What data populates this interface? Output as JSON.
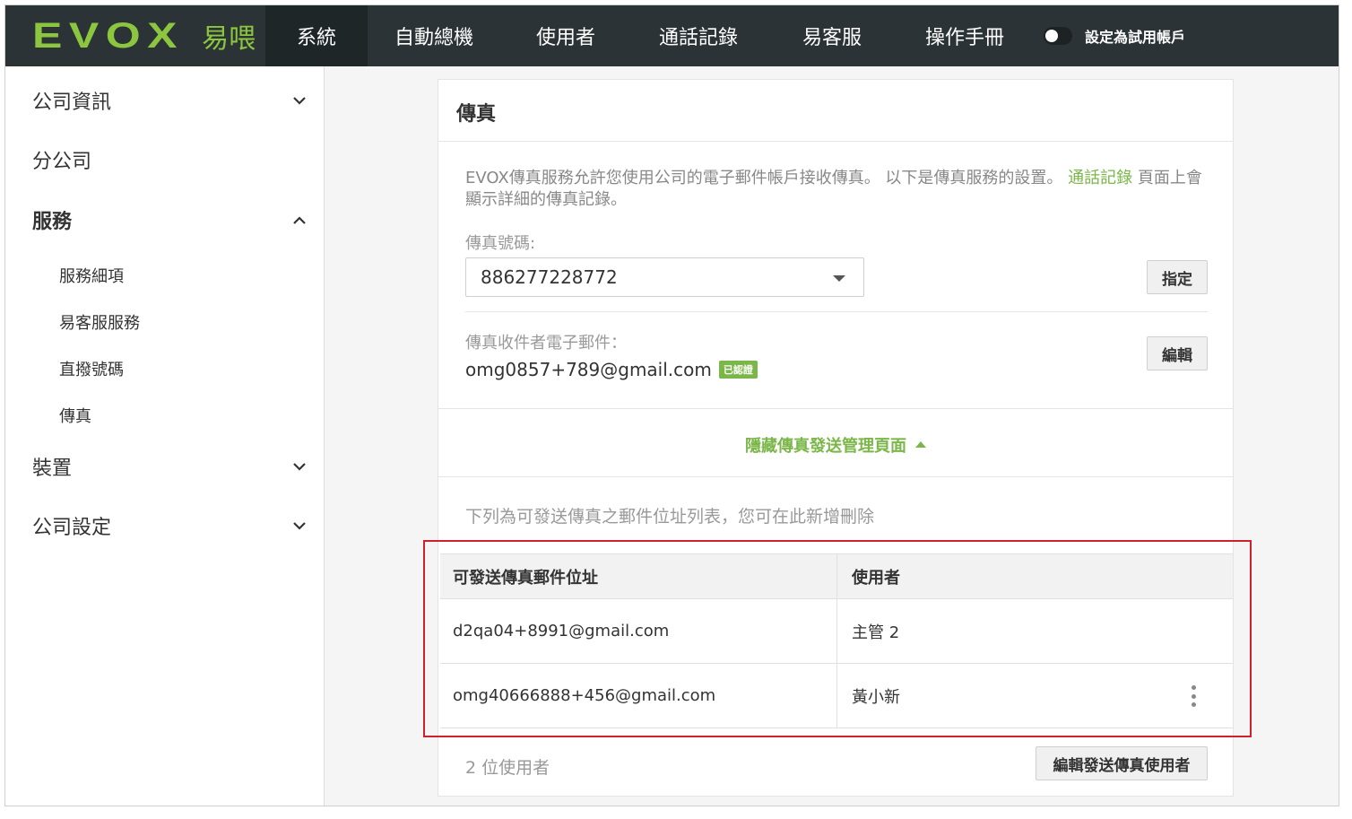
{
  "logo": {
    "mark": "EVOX",
    "sub": "易喂"
  },
  "nav": {
    "items": [
      {
        "label": "系統",
        "active": true
      },
      {
        "label": "自動總機",
        "active": false
      },
      {
        "label": "使用者",
        "active": false
      },
      {
        "label": "通話記錄",
        "active": false
      },
      {
        "label": "易客服",
        "active": false
      },
      {
        "label": "操作手冊",
        "active": false
      }
    ],
    "trial_label": "設定為試用帳戶"
  },
  "sidebar": {
    "company_info": "公司資訊",
    "branch": "分公司",
    "services": "服務",
    "service_items": [
      "服務細項",
      "易客服服務",
      "直撥號碼",
      "傳真"
    ],
    "devices": "裝置",
    "company_settings": "公司設定"
  },
  "fax": {
    "title": "傳真",
    "desc_before": "EVOX傳真服務允許您使用公司的電子郵件帳戶接收傳真。 以下是傳真服務的設置。 ",
    "desc_link": "通話記錄",
    "desc_after": " 頁面上會顯示詳細的傳真記錄。",
    "number_label": "傳真號碼:",
    "number_value": "886277228772",
    "assign_button": "指定",
    "recipient_label": "傳真收件者電子郵件：",
    "recipient_email": "omg0857+789@gmail.com",
    "verified_badge": "已認證",
    "edit_button": "編輯",
    "toggle_link": "隱藏傳真發送管理頁面",
    "list_desc": "下列為可發送傳真之郵件位址列表，您可在此新增刪除",
    "table": {
      "headers": [
        "可發送傳真郵件位址",
        "使用者"
      ],
      "rows": [
        {
          "email": "d2qa04+8991@gmail.com",
          "user": "主管 2"
        },
        {
          "email": "omg40666888+456@gmail.com",
          "user": "黃小新"
        }
      ]
    },
    "user_count": "2 位使用者",
    "edit_senders_button": "編輯發送傳真使用者"
  },
  "colors": {
    "accent": "#7ab648",
    "topbar": "#2b3336",
    "highlight": "#d0202e"
  }
}
